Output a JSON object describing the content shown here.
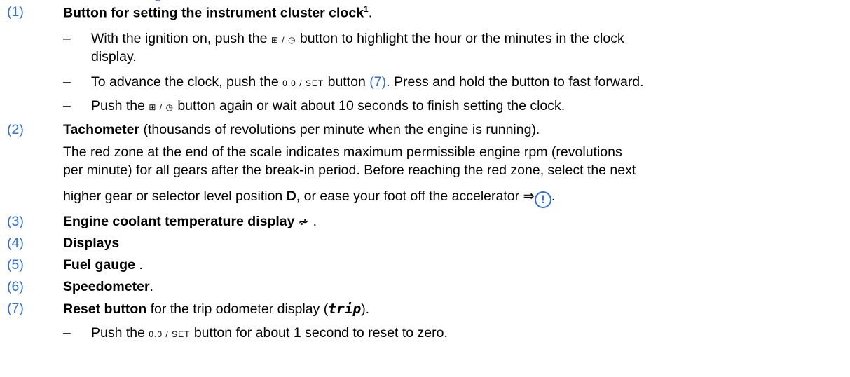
{
  "top_fragment": "g",
  "items": [
    {
      "number": "(1)",
      "title": "Button for setting the instrument cluster clock",
      "footnote": "1",
      "end": "."
    },
    {
      "number": "(2)",
      "title": "Tachometer",
      "rest": " (thousands of revolutions per minute when the engine is running)."
    },
    {
      "number": "(3)",
      "title": "Engine coolant temperature display",
      "rest": " ."
    },
    {
      "number": "(4)",
      "title": "Displays"
    },
    {
      "number": "(5)",
      "title": "Fuel gauge",
      "rest": " ."
    },
    {
      "number": "(6)",
      "title": "Speedometer",
      "rest": "."
    },
    {
      "number": "(7)",
      "title": "Reset button",
      "rest": " for the trip odometer display (",
      "trip": "trip",
      "end": ")."
    }
  ],
  "item1_steps": [
    {
      "a": "With the ignition on, push the ",
      "b": " button to highlight the hour or the minutes in the clock",
      "c": "display."
    },
    {
      "a": "To advance the clock, push the ",
      "b": " button ",
      "link": "(7)",
      "c": ". Press and hold the button to fast forward."
    },
    {
      "a": "Push the ",
      "b": " button again or wait about 10 seconds to finish setting the clock."
    }
  ],
  "item2_para": {
    "line1": "The red zone at the end of the scale indicates maximum permissible engine rpm (revolutions",
    "line2": "per minute) for all gears after the break-in period. Before reaching the red zone, select the next",
    "line3a": "higher gear or selector level position ",
    "line3b": "D",
    "line3c": ", or ease your foot off the accelerator ⇒",
    "line3d": "."
  },
  "item7_step": {
    "a": "Push the ",
    "b": " button for about 1 second to reset to zero."
  },
  "icons": {
    "clock_button": "⊞ / ◷",
    "set_button": "0.0 / SET",
    "coolant": "⩫",
    "warning": "!"
  },
  "colors": {
    "link": "#2f6fd6"
  }
}
